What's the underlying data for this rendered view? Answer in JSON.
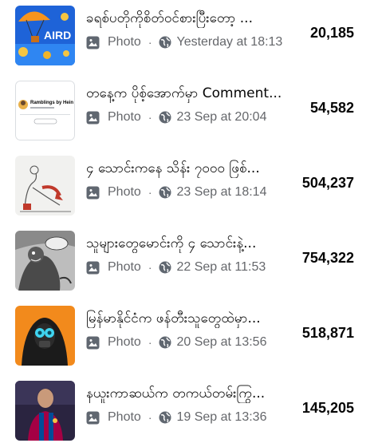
{
  "posts": [
    {
      "title": "ခရစ်ပတိုကိုစိတ်ဝင်စားပြီးတော့ ...",
      "type_label": "Photo",
      "time": "Yesterday at 18:13",
      "count": "20,185",
      "thumb_icon": "airdrop-coins-image",
      "thumb_text": "AIRD"
    },
    {
      "title": "တနေ့က ပိုစ့်အောက်မှာ Comment...",
      "type_label": "Photo",
      "time": "23 Sep at 20:04",
      "count": "54,582",
      "thumb_icon": "newsletter-card-image",
      "thumb_text": "Ramblings by Hein"
    },
    {
      "title": "၄ သောင်းကနေ သိန်း ၇၀၀၀ ဖြစ်...",
      "type_label": "Photo",
      "time": "23 Sep at 18:14",
      "count": "504,237",
      "thumb_icon": "sketch-arrow-image"
    },
    {
      "title": "သူများတွေမောင်းကို ၄ သောင်းနဲ့...",
      "type_label": "Photo",
      "time": "22 Sep at 11:53",
      "count": "754,322",
      "thumb_icon": "cartoon-monkey-image"
    },
    {
      "title": "မြန်မာနိုင်ငံက ဖန်တီးသူတွေထဲမှာ...",
      "type_label": "Photo",
      "time": "20 Sep at 13:56",
      "count": "518,871",
      "thumb_icon": "hooded-avatar-image"
    },
    {
      "title": "နယူးကာဆယ်က တကယ်တမ်းကြွ...",
      "type_label": "Photo",
      "time": "19 Sep at 13:36",
      "count": "145,205",
      "thumb_icon": "football-player-image"
    }
  ],
  "colors": {
    "text": "#050505",
    "meta": "#65676b",
    "background": "#ffffff"
  },
  "icons": {
    "photo": "photo-icon",
    "audience": "globe-icon"
  }
}
